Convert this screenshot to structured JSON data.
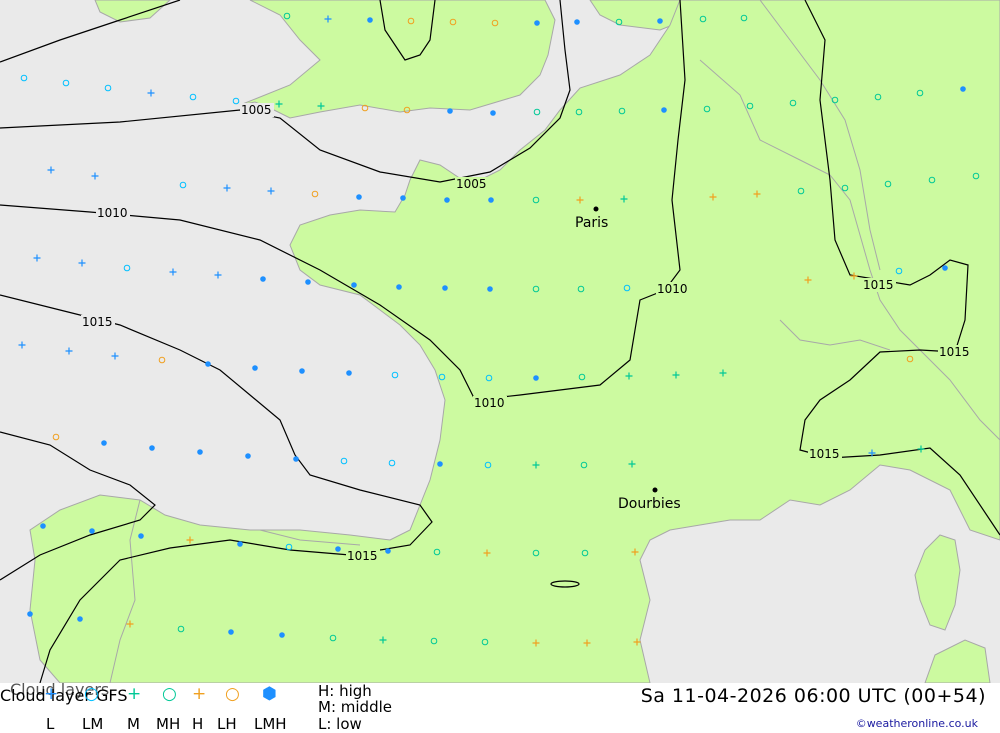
{
  "map": {
    "sea_color": "#eaeaea",
    "land_color": "#ccfaa0",
    "isobar_color": "#000000",
    "cities": [
      {
        "name": "Paris"
      },
      {
        "name": "Dourbies"
      }
    ],
    "isobars": [
      "1005",
      "1005",
      "1010",
      "1010",
      "1010",
      "1015",
      "1015",
      "1015",
      "1015",
      "1015"
    ]
  },
  "legend": {
    "title_primary": "Cloud layers",
    "title_secondary": "Cloud layer   GFS",
    "symbols": [
      {
        "code": "L",
        "glyph": "+",
        "color": "#1e90ff"
      },
      {
        "code": "LM",
        "glyph": "○",
        "color": "#00bfff"
      },
      {
        "code": "M",
        "glyph": "+",
        "color": "#00c896"
      },
      {
        "code": "MH",
        "glyph": "○",
        "color": "#00c896"
      },
      {
        "code": "H",
        "glyph": "+",
        "color": "#f0a020"
      },
      {
        "code": "LH",
        "glyph": "○",
        "color": "#f0a020"
      },
      {
        "code": "LMH",
        "glyph": "⬢",
        "color": "#1e90ff"
      }
    ],
    "key_high": "H:  high",
    "key_middle": "M:  middle",
    "key_low": "L:  low",
    "datetime": "Sa 11-04-2026 06:00 UTC (00+54)",
    "credit": "©weatheronline.co.uk"
  }
}
